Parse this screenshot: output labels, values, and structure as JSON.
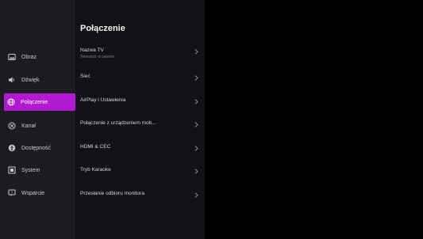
{
  "sidebar": {
    "items": [
      {
        "label": "Obraz",
        "icon": "image-icon"
      },
      {
        "label": "Dźwięk",
        "icon": "speaker-icon"
      },
      {
        "label": "Połączenie",
        "icon": "globe-icon"
      },
      {
        "label": "Kanał",
        "icon": "channel-icon"
      },
      {
        "label": "Dostępność",
        "icon": "accessibility-icon"
      },
      {
        "label": "System",
        "icon": "system-icon"
      },
      {
        "label": "Wsparcie",
        "icon": "support-icon"
      }
    ],
    "active_index": 2
  },
  "panel": {
    "title": "Połączenie",
    "rows": [
      {
        "label": "Nazwa TV",
        "sublabel": "Telewizor w salonie"
      },
      {
        "label": "Sieć",
        "sublabel": ""
      },
      {
        "label": "AirPlay i Ustawienia",
        "sublabel": ""
      },
      {
        "label": "Połączenie z urządzeniem mob...",
        "sublabel": ""
      },
      {
        "label": "HDMI & CEC",
        "sublabel": ""
      },
      {
        "label": "Tryb Karaoke",
        "sublabel": ""
      },
      {
        "label": "Przesłanie odbioru monitora",
        "sublabel": ""
      }
    ]
  },
  "colors": {
    "accent": "#b21ad1",
    "sidebar_bg": "#1b1c21",
    "panel_bg": "#111216",
    "background": "#000000"
  }
}
